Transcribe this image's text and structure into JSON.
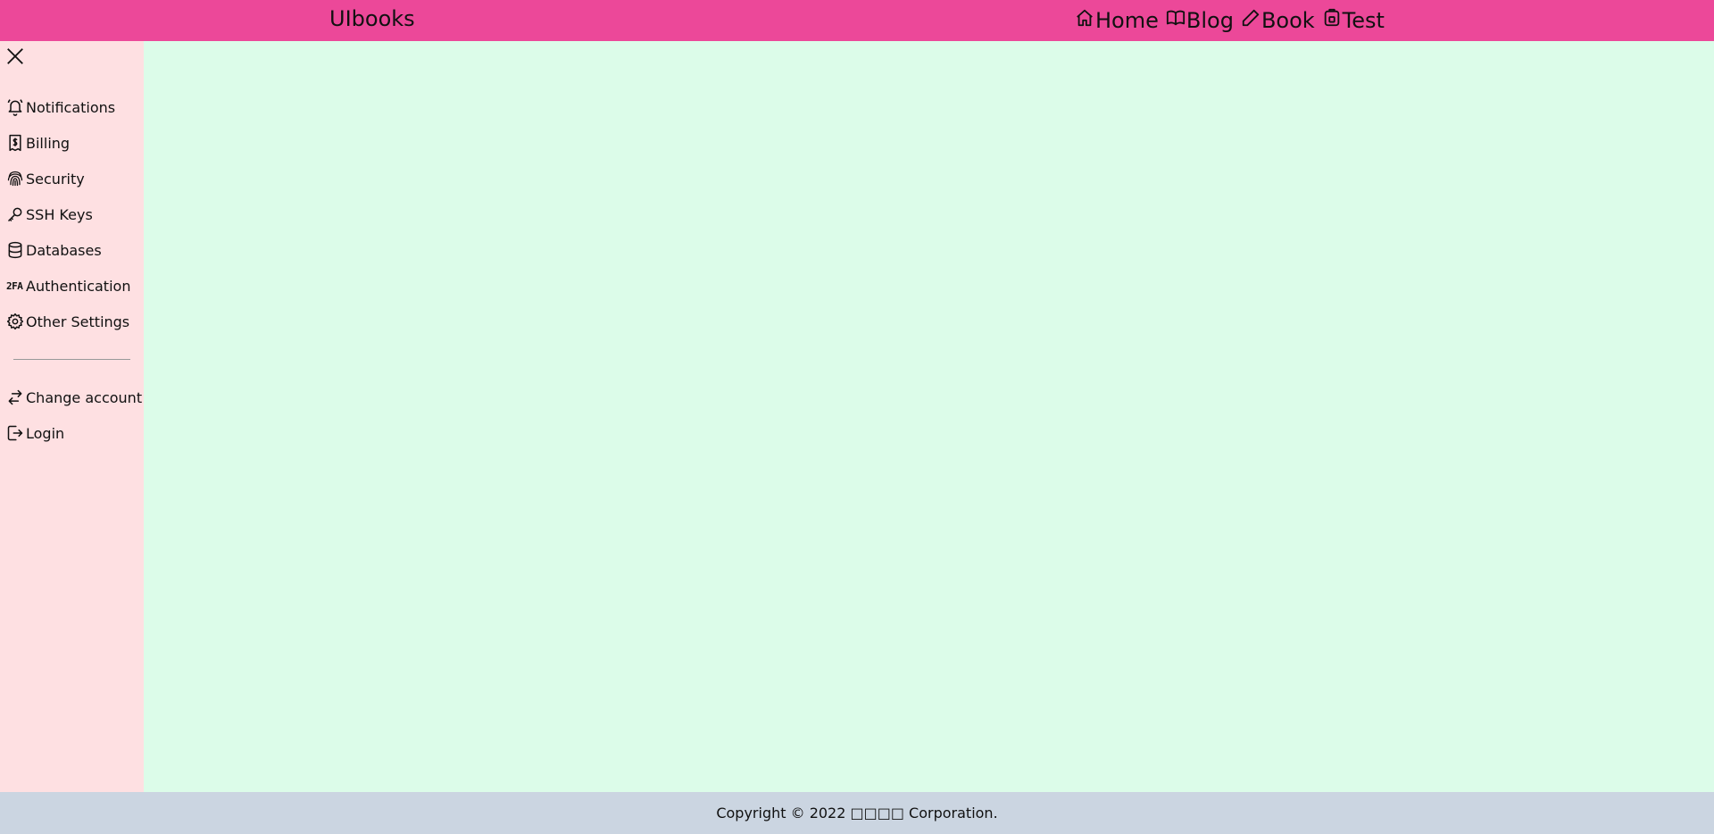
{
  "header": {
    "brand": "UIbooks",
    "nav": [
      {
        "label": "Home",
        "icon": "home-icon"
      },
      {
        "label": "Blog",
        "icon": "book-open-icon"
      },
      {
        "label": "Book",
        "icon": "pencil-icon"
      },
      {
        "label": "Test",
        "icon": "flask-icon"
      }
    ],
    "background": "#ec4899"
  },
  "sidebar": {
    "close_icon": "close-icon",
    "items": [
      {
        "label": "Notifications",
        "icon": "bell-icon"
      },
      {
        "label": "Billing",
        "icon": "receipt-icon"
      },
      {
        "label": "Security",
        "icon": "fingerprint-icon"
      },
      {
        "label": "SSH Keys",
        "icon": "key-icon"
      },
      {
        "label": "Databases",
        "icon": "database-icon"
      },
      {
        "label": "Authentication",
        "icon": "twofa-icon",
        "icon_text": "2FA"
      },
      {
        "label": "Other Settings",
        "icon": "gear-icon"
      }
    ],
    "account_items": [
      {
        "label": "Change account",
        "icon": "switch-icon"
      },
      {
        "label": "Login",
        "icon": "login-icon"
      }
    ],
    "background": "#fee0e2"
  },
  "main": {
    "background": "#dcfce9"
  },
  "footer": {
    "text": "Copyright © 2022 □□□□ Corporation.",
    "background": "#cbd5e1"
  }
}
